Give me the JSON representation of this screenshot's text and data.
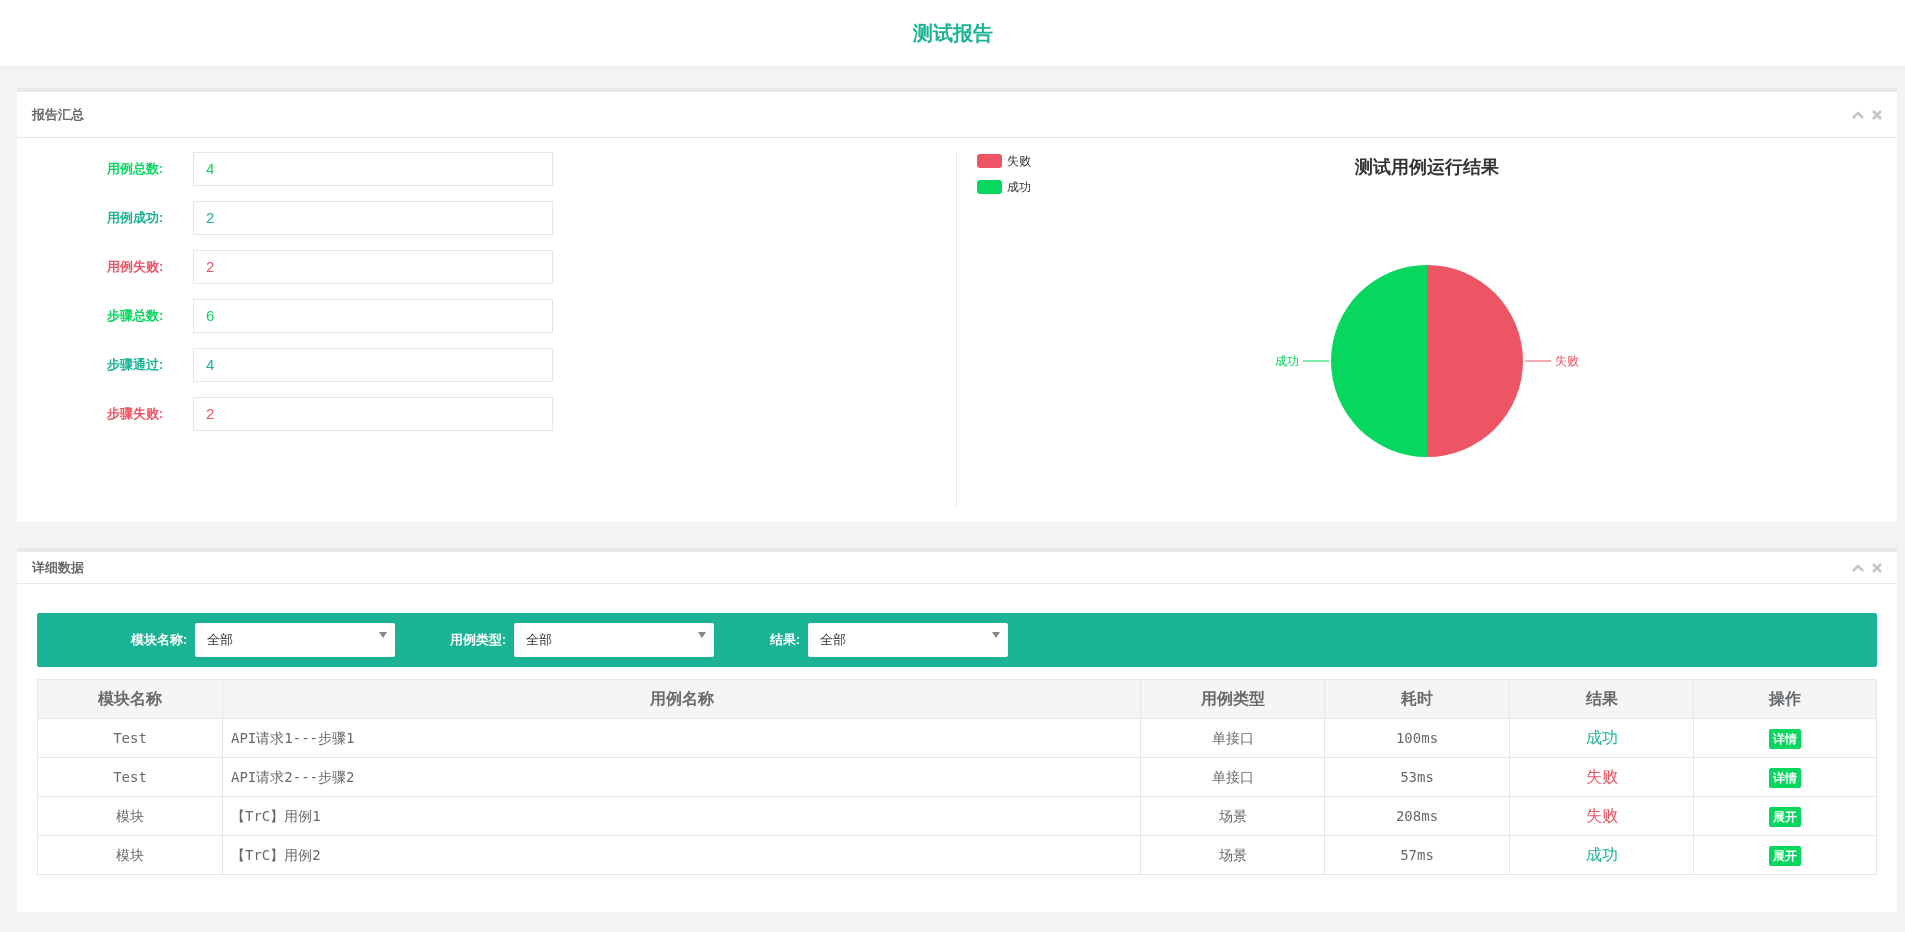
{
  "header": {
    "title": "测试报告"
  },
  "summary_panel": {
    "title": "报告汇总",
    "stats": [
      {
        "label": "用例总数:",
        "value": "4",
        "kind": "total"
      },
      {
        "label": "用例成功:",
        "value": "2",
        "kind": "success"
      },
      {
        "label": "用例失败:",
        "value": "2",
        "kind": "fail"
      },
      {
        "label": "步骤总数:",
        "value": "6",
        "kind": "total"
      },
      {
        "label": "步骤通过:",
        "value": "4",
        "kind": "success"
      },
      {
        "label": "步骤失败:",
        "value": "2",
        "kind": "fail"
      }
    ],
    "legend": [
      {
        "label": "失败",
        "color": "#ed5565"
      },
      {
        "label": "成功",
        "color": "#07d75f"
      }
    ],
    "pie_chart": {
      "title": "测试用例运行结果",
      "slices": [
        {
          "label": "成功",
          "color": "#07d75f"
        },
        {
          "label": "失败",
          "color": "#ed5565"
        }
      ]
    }
  },
  "detail_panel": {
    "title": "详细数据",
    "filters": [
      {
        "label": "模块名称:",
        "value": "全部"
      },
      {
        "label": "用例类型:",
        "value": "全部"
      },
      {
        "label": "结果:",
        "value": "全部"
      }
    ],
    "table": {
      "columns": [
        "模块名称",
        "用例名称",
        "用例类型",
        "耗时",
        "结果",
        "操作"
      ],
      "rows": [
        {
          "module": "Test",
          "name": "API请求1---步骤1",
          "type": "单接口",
          "time": "100ms",
          "result": "成功",
          "kind": "success",
          "action": "详情"
        },
        {
          "module": "Test",
          "name": "API请求2---步骤2",
          "type": "单接口",
          "time": "53ms",
          "result": "失败",
          "kind": "fail",
          "action": "详情"
        },
        {
          "module": "模块",
          "name": "【TrC】用例1",
          "type": "场景",
          "time": "208ms",
          "result": "失败",
          "kind": "fail",
          "action": "展开"
        },
        {
          "module": "模块",
          "name": "【TrC】用例2",
          "type": "场景",
          "time": "57ms",
          "result": "成功",
          "kind": "success",
          "action": "展开"
        }
      ]
    }
  }
}
